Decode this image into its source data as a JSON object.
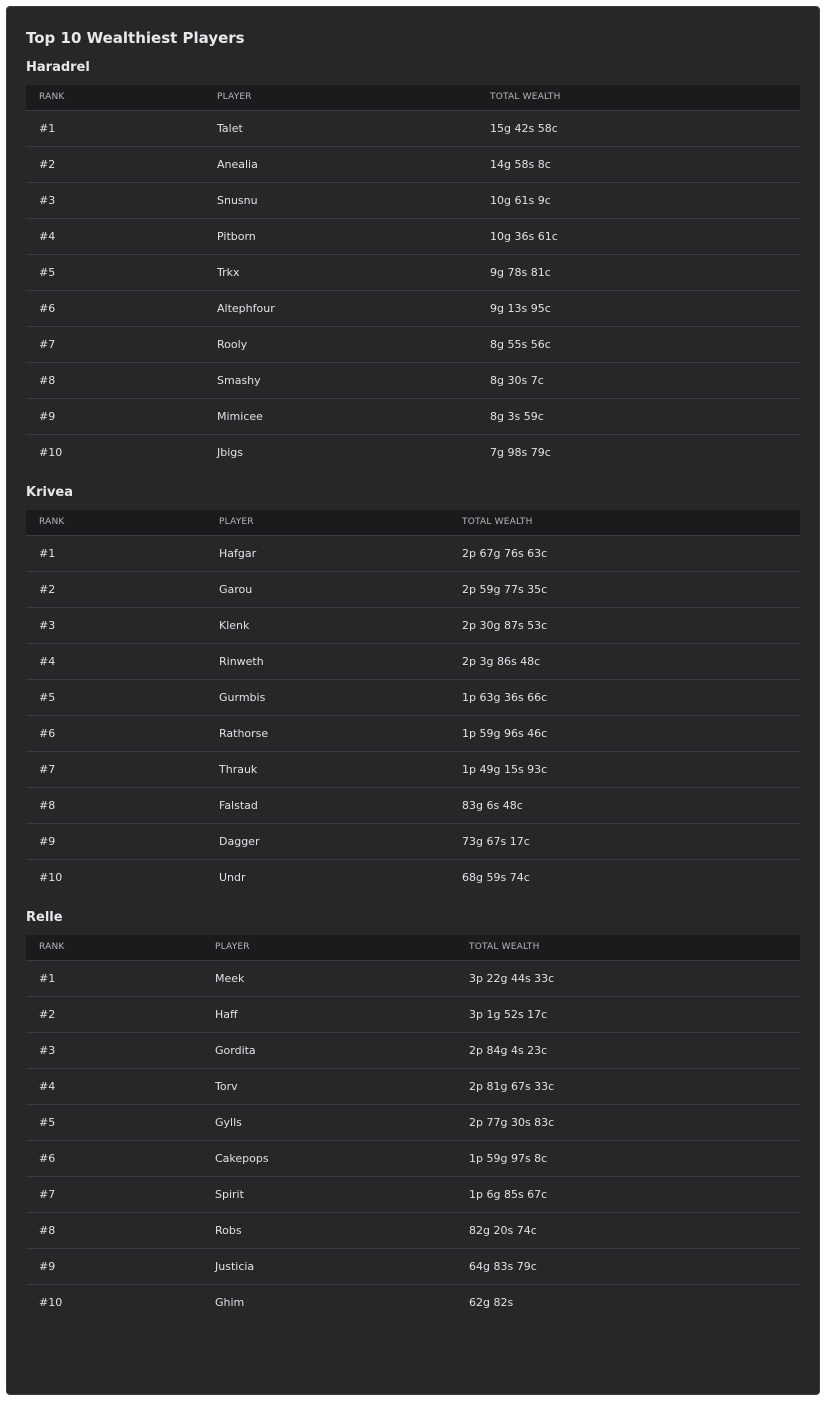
{
  "page": {
    "title": "Top 10 Wealthiest Players"
  },
  "columns": {
    "rank": "RANK",
    "player": "PLAYER",
    "wealth": "TOTAL WEALTH"
  },
  "realms": [
    {
      "name": "Haradrel",
      "rows": [
        {
          "rank": "#1",
          "player": "Talet",
          "wealth": "15g 42s 58c"
        },
        {
          "rank": "#2",
          "player": "Anealia",
          "wealth": "14g 58s 8c"
        },
        {
          "rank": "#3",
          "player": "Snusnu",
          "wealth": "10g 61s 9c"
        },
        {
          "rank": "#4",
          "player": "Pitborn",
          "wealth": "10g 36s 61c"
        },
        {
          "rank": "#5",
          "player": "Trkx",
          "wealth": "9g 78s 81c"
        },
        {
          "rank": "#6",
          "player": "Altephfour",
          "wealth": "9g 13s 95c"
        },
        {
          "rank": "#7",
          "player": "Rooly",
          "wealth": "8g 55s 56c"
        },
        {
          "rank": "#8",
          "player": "Smashy",
          "wealth": "8g 30s 7c"
        },
        {
          "rank": "#9",
          "player": "Mimicee",
          "wealth": "8g 3s 59c"
        },
        {
          "rank": "#10",
          "player": "Jbigs",
          "wealth": "7g 98s 79c"
        }
      ]
    },
    {
      "name": "Krivea",
      "rows": [
        {
          "rank": "#1",
          "player": "Hafgar",
          "wealth": "2p 67g 76s 63c"
        },
        {
          "rank": "#2",
          "player": "Garou",
          "wealth": "2p 59g 77s 35c"
        },
        {
          "rank": "#3",
          "player": "Klenk",
          "wealth": "2p 30g 87s 53c"
        },
        {
          "rank": "#4",
          "player": "Rinweth",
          "wealth": "2p 3g 86s 48c"
        },
        {
          "rank": "#5",
          "player": "Gurmbis",
          "wealth": "1p 63g 36s 66c"
        },
        {
          "rank": "#6",
          "player": "Rathorse",
          "wealth": "1p 59g 96s 46c"
        },
        {
          "rank": "#7",
          "player": "Thrauk",
          "wealth": "1p 49g 15s 93c"
        },
        {
          "rank": "#8",
          "player": "Falstad",
          "wealth": "83g 6s 48c"
        },
        {
          "rank": "#9",
          "player": "Dagger",
          "wealth": "73g 67s 17c"
        },
        {
          "rank": "#10",
          "player": "Undr",
          "wealth": "68g 59s 74c"
        }
      ]
    },
    {
      "name": "Relle",
      "rows": [
        {
          "rank": "#1",
          "player": "Meek",
          "wealth": "3p 22g 44s 33c"
        },
        {
          "rank": "#2",
          "player": "Haff",
          "wealth": "3p 1g 52s 17c"
        },
        {
          "rank": "#3",
          "player": "Gordita",
          "wealth": "2p 84g 4s 23c"
        },
        {
          "rank": "#4",
          "player": "Torv",
          "wealth": "2p 81g 67s 33c"
        },
        {
          "rank": "#5",
          "player": "Gylls",
          "wealth": "2p 77g 30s 83c"
        },
        {
          "rank": "#6",
          "player": "Cakepops",
          "wealth": "1p 59g 97s 8c"
        },
        {
          "rank": "#7",
          "player": "Spirit",
          "wealth": "1p 6g 85s 67c"
        },
        {
          "rank": "#8",
          "player": "Robs",
          "wealth": "82g 20s 74c"
        },
        {
          "rank": "#9",
          "player": "Justicia",
          "wealth": "64g 83s 79c"
        },
        {
          "rank": "#10",
          "player": "Ghim",
          "wealth": "62g 82s"
        }
      ]
    }
  ]
}
